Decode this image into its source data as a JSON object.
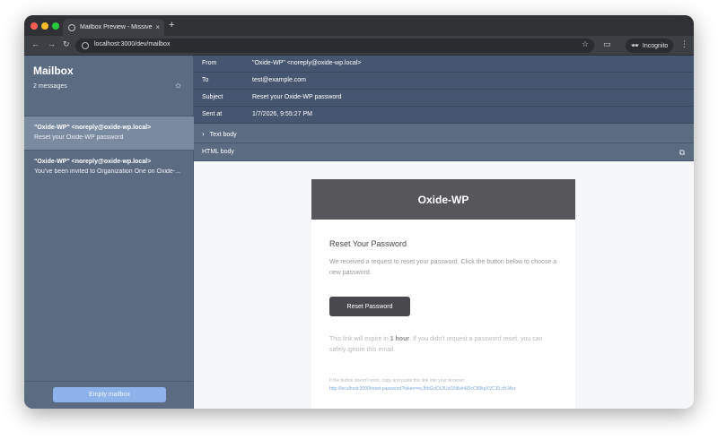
{
  "browser": {
    "tab_title": "Mailbox Preview - Missive",
    "tab_close": "×",
    "new_tab": "+",
    "back": "←",
    "forward": "→",
    "reload": "↻",
    "url": "localhost:3000/dev/mailbox",
    "star": "☆",
    "incognito_label": "Incognito",
    "menu": "⋮"
  },
  "sidebar": {
    "title": "Mailbox",
    "count": "2 messages",
    "theme_icon": "☼",
    "messages": [
      {
        "from": "\"Oxide-WP\" <noreply@oxide-wp.local>",
        "subject": "Reset your Oxide-WP password"
      },
      {
        "from": "\"Oxide-WP\" <noreply@oxide-wp.local>",
        "subject": "You've been invited to Organization One on Oxide-..."
      }
    ],
    "empty_button": "Empty mailbox"
  },
  "headers": [
    {
      "key": "From",
      "value": "\"Oxide-WP\" <noreply@oxide-wp.local>"
    },
    {
      "key": "To",
      "value": "test@example.com"
    },
    {
      "key": "Subject",
      "value": "Reset your Oxide-WP password"
    },
    {
      "key": "Sent at",
      "value": "1/7/2026, 9:55:27 PM"
    }
  ],
  "sections": {
    "text_body": "Text body",
    "text_chevron": "›",
    "html_body": "HTML body",
    "external_icon": "⧉"
  },
  "email": {
    "brand": "Oxide-WP",
    "heading": "Reset Your Password",
    "paragraph": "We received a request to reset your password. Click the button below to choose a new password.",
    "button": "Reset Password",
    "expire_prefix": "This link will expire in ",
    "expire_bold": "1 hour",
    "expire_suffix": ". If you didn't request a password reset, you can safely ignore this email.",
    "fallback_note": "If the button doesn't work, copy and paste this link into your browser:",
    "fallback_link": "http://localhost:3000/reset-password?token=eyJhbGciOiJIUzI1NiIsInR5cCI6IkpXVCJ9.cHJ4xz"
  }
}
